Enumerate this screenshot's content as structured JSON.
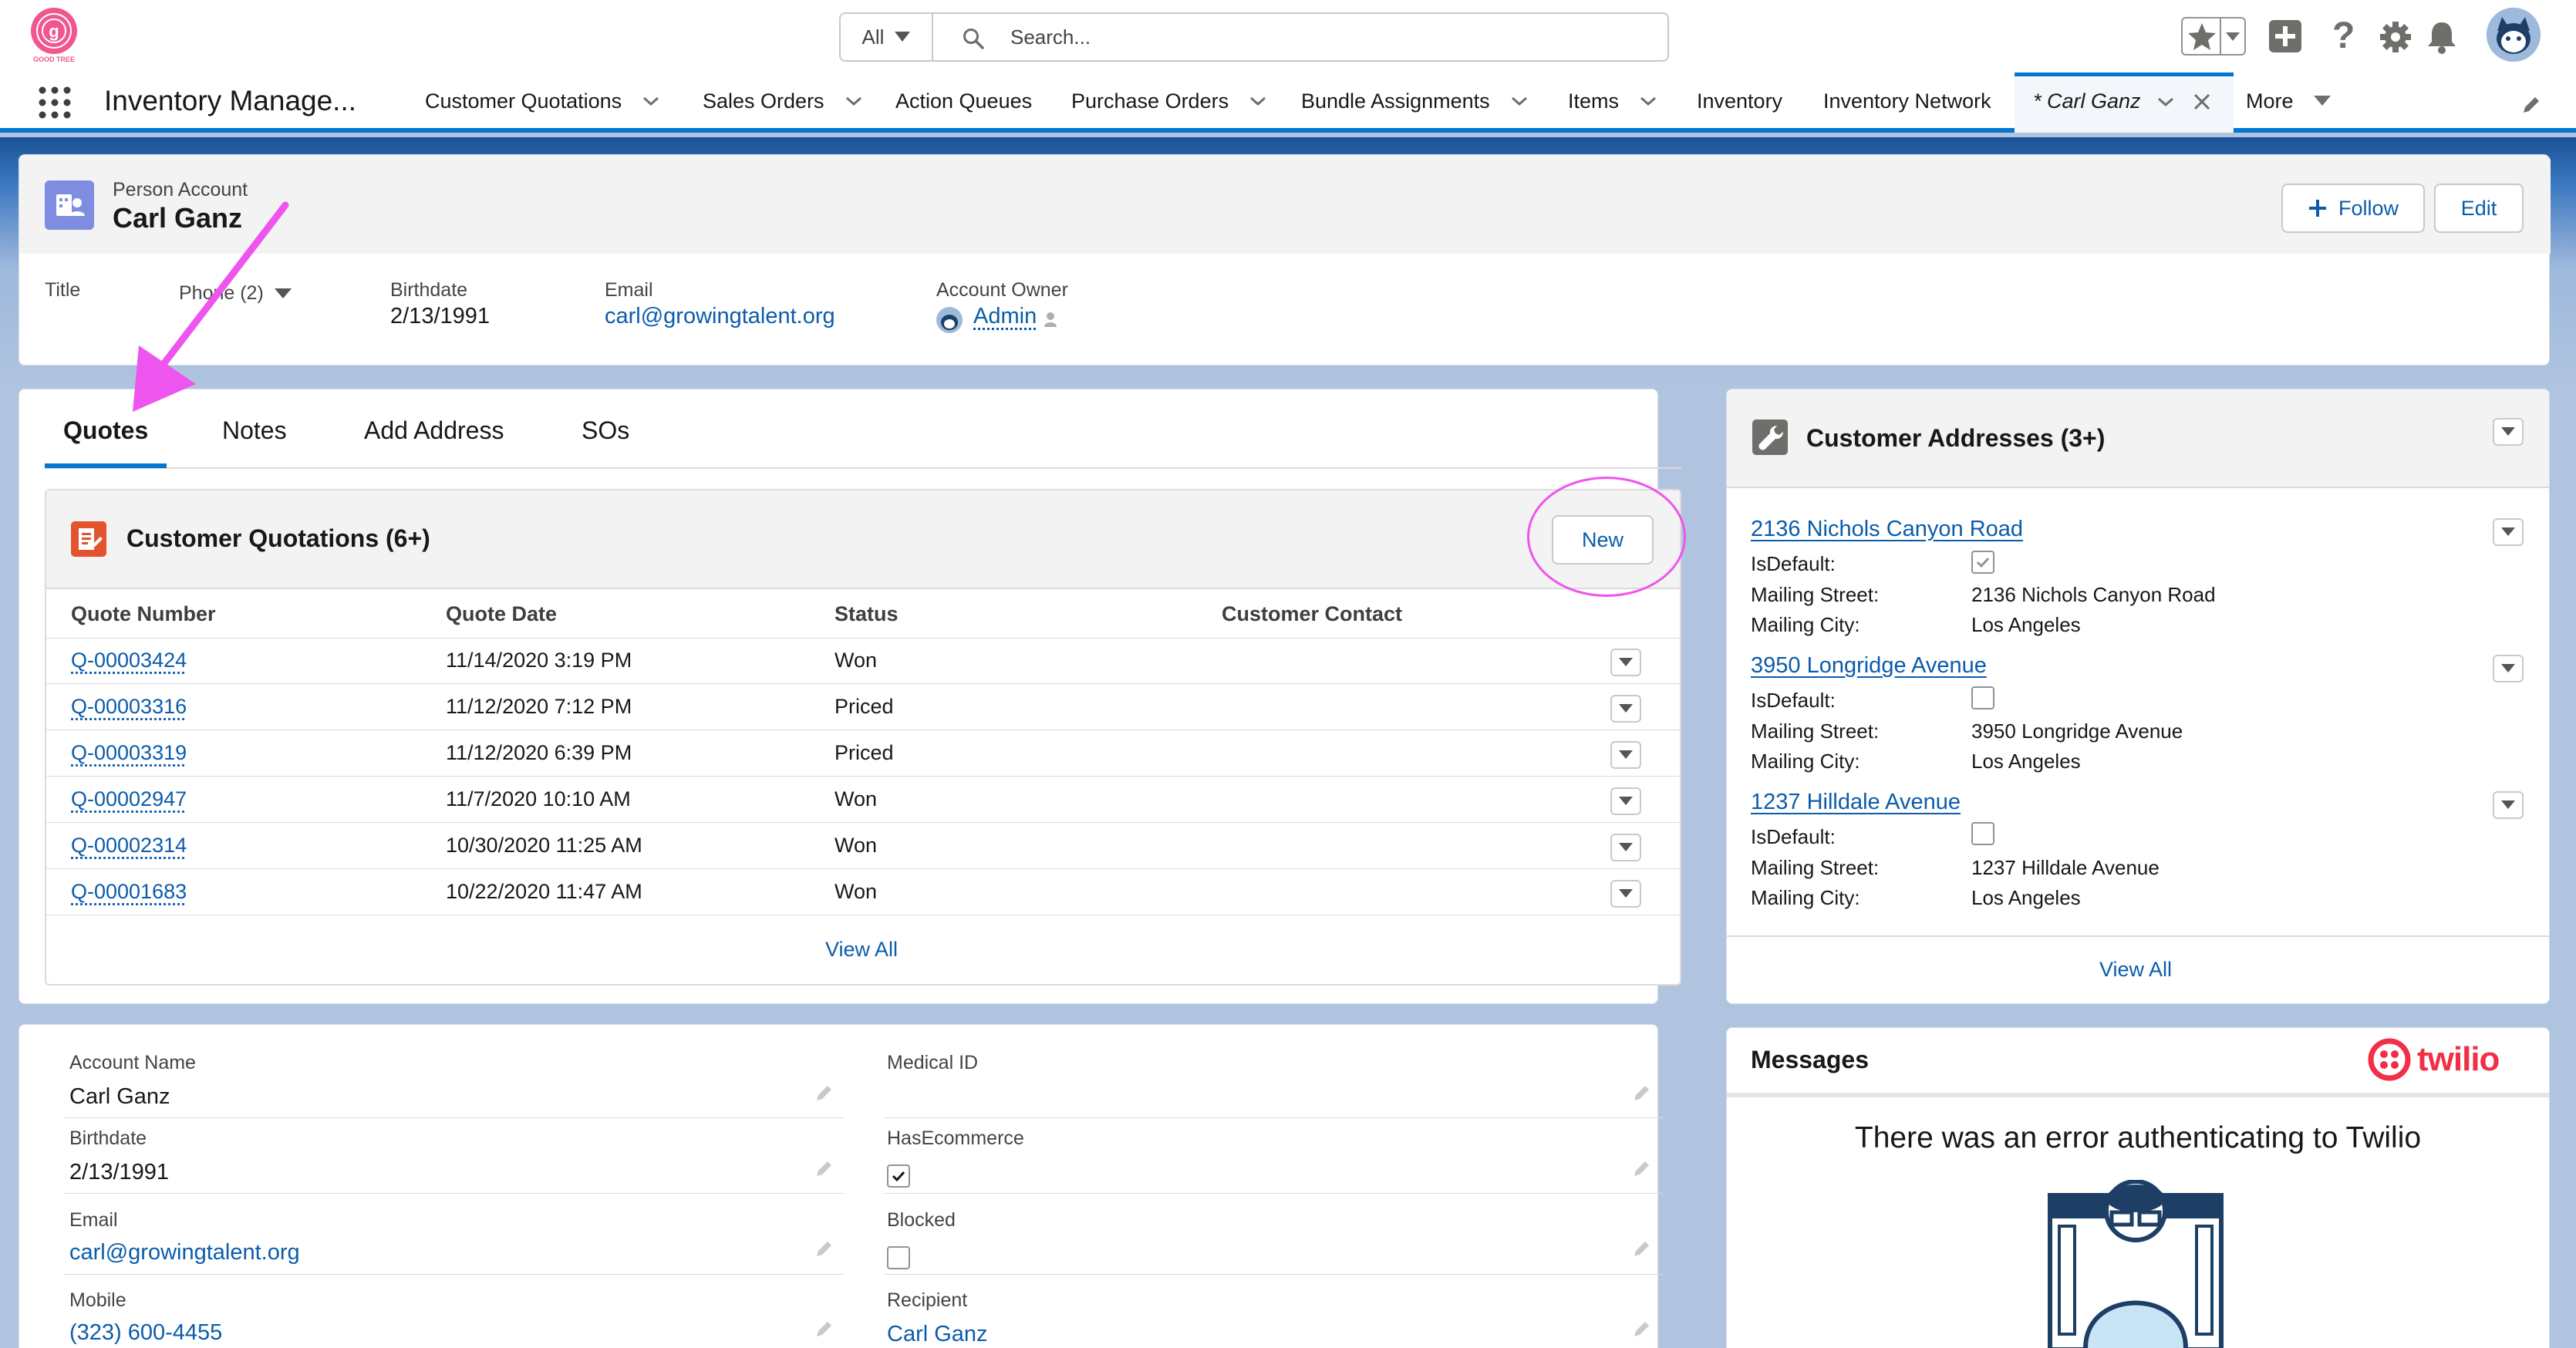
{
  "header": {
    "brand_text": "GOOD TREE",
    "search_scope": "All",
    "search_placeholder": "Search..."
  },
  "nav": {
    "app_name": "Inventory Manage...",
    "items": [
      {
        "label": "Customer Quotations",
        "has_menu": true
      },
      {
        "label": "Sales Orders",
        "has_menu": true
      },
      {
        "label": "Action Queues",
        "has_menu": false
      },
      {
        "label": "Purchase Orders",
        "has_menu": true
      },
      {
        "label": "Bundle Assignments",
        "has_menu": true
      },
      {
        "label": "Items",
        "has_menu": true
      },
      {
        "label": "Inventory",
        "has_menu": false
      },
      {
        "label": "Inventory Network",
        "has_menu": false
      }
    ],
    "active_tab": "* Carl Ganz",
    "more_label": "More"
  },
  "highlights": {
    "object_type": "Person Account",
    "name": "Carl Ganz",
    "follow_label": "Follow",
    "edit_label": "Edit",
    "fields": {
      "title_label": "Title",
      "phone_label": "Phone (2)",
      "birthdate_label": "Birthdate",
      "birthdate_value": "2/13/1991",
      "email_label": "Email",
      "email_value": "carl@growingtalent.org",
      "owner_label": "Account Owner",
      "owner_value": "Admin"
    }
  },
  "tabs": [
    "Quotes",
    "Notes",
    "Add Address",
    "SOs"
  ],
  "quotations": {
    "title": "Customer Quotations (6+)",
    "new_label": "New",
    "columns": [
      "Quote Number",
      "Quote Date",
      "Status",
      "Customer Contact"
    ],
    "rows": [
      {
        "number": "Q-00003424",
        "date": "11/14/2020 3:19 PM",
        "status": "Won",
        "contact": ""
      },
      {
        "number": "Q-00003316",
        "date": "11/12/2020 7:12 PM",
        "status": "Priced",
        "contact": ""
      },
      {
        "number": "Q-00003319",
        "date": "11/12/2020 6:39 PM",
        "status": "Priced",
        "contact": ""
      },
      {
        "number": "Q-00002947",
        "date": "11/7/2020 10:10 AM",
        "status": "Won",
        "contact": ""
      },
      {
        "number": "Q-00002314",
        "date": "10/30/2020 11:25 AM",
        "status": "Won",
        "contact": ""
      },
      {
        "number": "Q-00001683",
        "date": "10/22/2020 11:47 AM",
        "status": "Won",
        "contact": ""
      }
    ],
    "view_all": "View All"
  },
  "addresses": {
    "title": "Customer Addresses (3+)",
    "labels": {
      "default": "IsDefault:",
      "street": "Mailing Street:",
      "city": "Mailing City:"
    },
    "items": [
      {
        "name": "2136 Nichols Canyon Road",
        "is_default": true,
        "street": "2136 Nichols Canyon Road",
        "city": "Los Angeles"
      },
      {
        "name": "3950 Longridge Avenue",
        "is_default": false,
        "street": "3950 Longridge Avenue",
        "city": "Los Angeles"
      },
      {
        "name": "1237 Hilldale Avenue",
        "is_default": false,
        "street": "1237 Hilldale Avenue",
        "city": "Los Angeles"
      }
    ],
    "view_all": "View All"
  },
  "details": {
    "left": [
      {
        "label": "Account Name",
        "value": "Carl Ganz",
        "is_link": false
      },
      {
        "label": "Birthdate",
        "value": "2/13/1991",
        "is_link": false
      },
      {
        "label": "Email",
        "value": "carl@growingtalent.org",
        "is_link": true
      },
      {
        "label": "Mobile",
        "value": "(323) 600-4455",
        "is_link": true
      }
    ],
    "right": [
      {
        "label": "Medical ID",
        "value": "",
        "type": "text"
      },
      {
        "label": "HasEcommerce",
        "checked": true,
        "type": "checkbox"
      },
      {
        "label": "Blocked",
        "checked": false,
        "type": "checkbox"
      },
      {
        "label": "Recipient",
        "value": "Carl Ganz",
        "type": "link"
      }
    ]
  },
  "messages": {
    "title": "Messages",
    "brand": "twilio",
    "brand_color": "#f22f46",
    "error_text": "There was an error authenticating to Twilio"
  },
  "colors": {
    "brand_blue": "#0176d3",
    "annotation_magenta": "#ee55ee",
    "link": "#0b5cab"
  }
}
